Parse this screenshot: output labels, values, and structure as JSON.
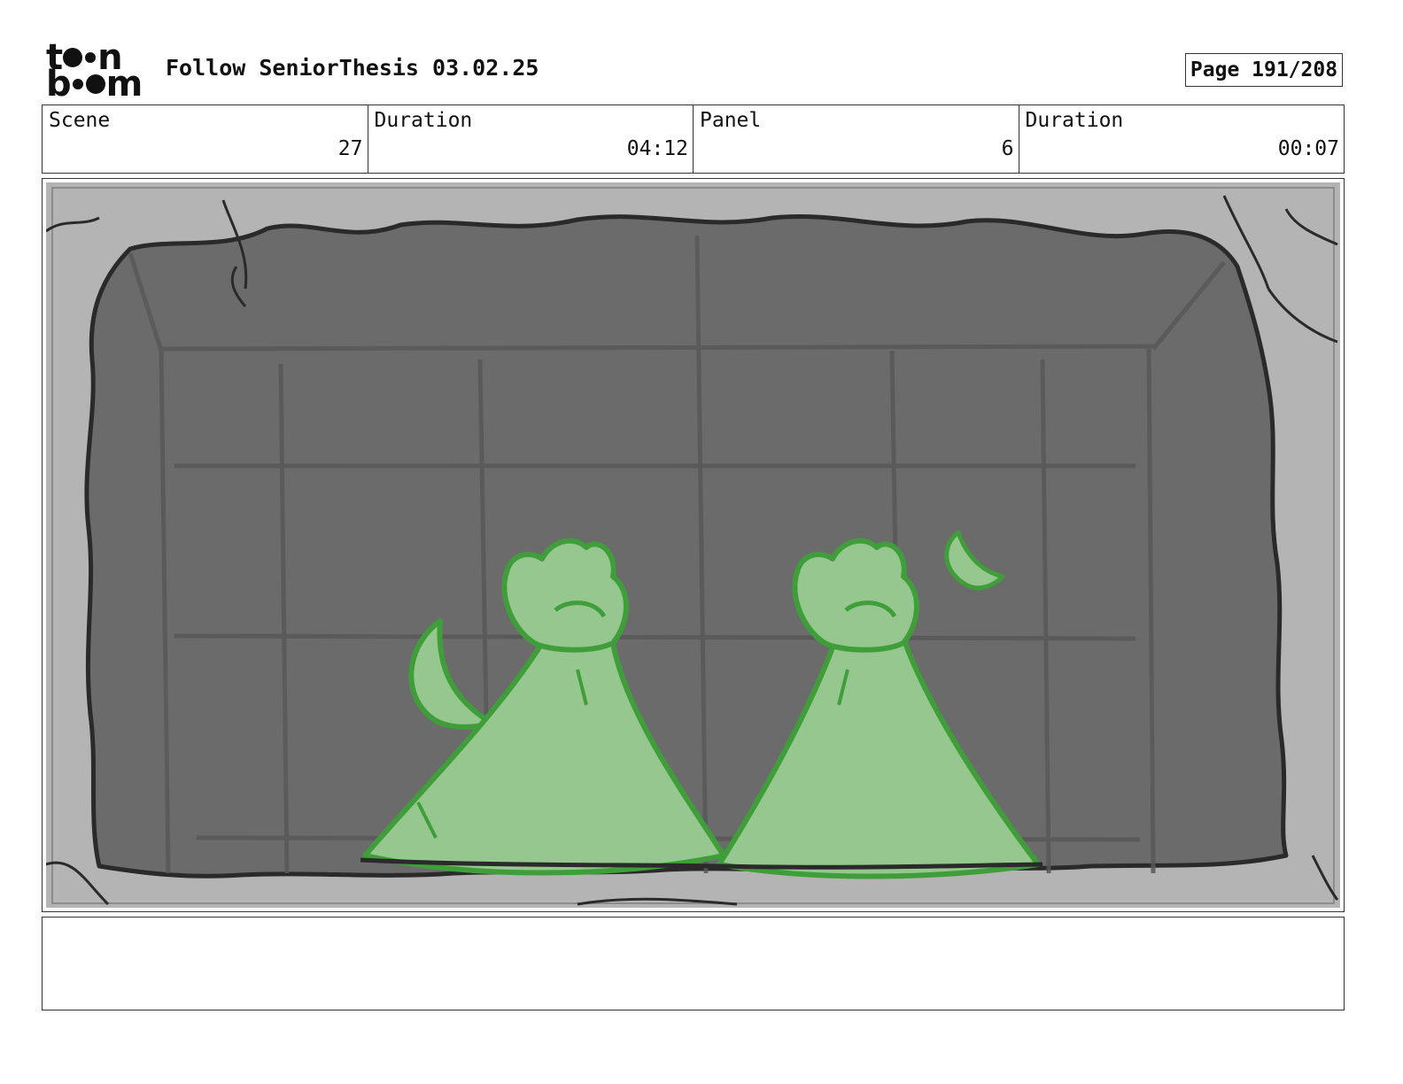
{
  "header": {
    "logo_top": "t",
    "logo_top_end": "n",
    "logo_bottom_start": "b",
    "logo_bottom_end": "m",
    "logo_icon": "toon-boom-logo-icon",
    "title": "Follow SeniorThesis 03.02.25",
    "page": "Page 191/208"
  },
  "info": {
    "scene_label": "Scene",
    "scene_value": "27",
    "scene_duration_label": "Duration",
    "scene_duration_value": "04:12",
    "panel_label": "Panel",
    "panel_value": "6",
    "panel_duration_label": "Duration",
    "panel_duration_value": "00:07"
  },
  "colors": {
    "wall": "#6b6b6b",
    "rim": "#b4b4b4",
    "ghost_fill": "#96c78e",
    "ghost_stroke": "#3f9e3a",
    "ink": "#2a2a2a"
  },
  "notes": {
    "text": ""
  }
}
